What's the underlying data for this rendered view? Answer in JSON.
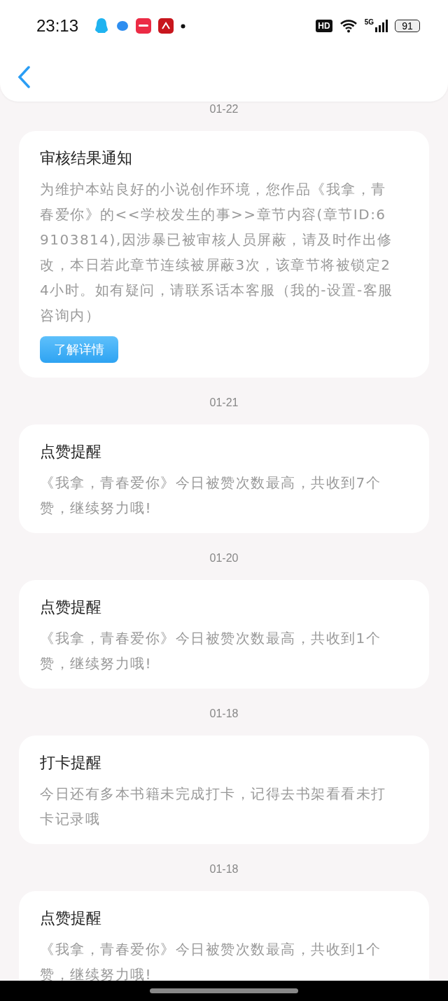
{
  "status_bar": {
    "time": "23:13",
    "hd": "HD",
    "network": "5G",
    "battery": "91"
  },
  "groups": [
    {
      "date": "01-22",
      "title": "审核结果通知",
      "body": "为维护本站良好的小说创作环境，您作品《我拿，青春爱你》的<<学校发生的事>>章节内容(章节ID:69103814),因涉暴已被审核人员屏蔽，请及时作出修改，本日若此章节连续被屏蔽3次，该章节将被锁定24小时。如有疑问，请联系话本客服（我的-设置-客服咨询内）",
      "button": "了解详情"
    },
    {
      "date": "01-21",
      "title": "点赞提醒",
      "body": "《我拿，青春爱你》今日被赞次数最高，共收到7个赞，继续努力哦!"
    },
    {
      "date": "01-20",
      "title": "点赞提醒",
      "body": "《我拿，青春爱你》今日被赞次数最高，共收到1个赞，继续努力哦!"
    },
    {
      "date": "01-18",
      "title": "打卡提醒",
      "body": "今日还有多本书籍未完成打卡，记得去书架看看未打卡记录哦"
    },
    {
      "date": "01-18",
      "title": "点赞提醒",
      "body": "《我拿，青春爱你》今日被赞次数最高，共收到1个赞，继续努力哦!"
    }
  ]
}
